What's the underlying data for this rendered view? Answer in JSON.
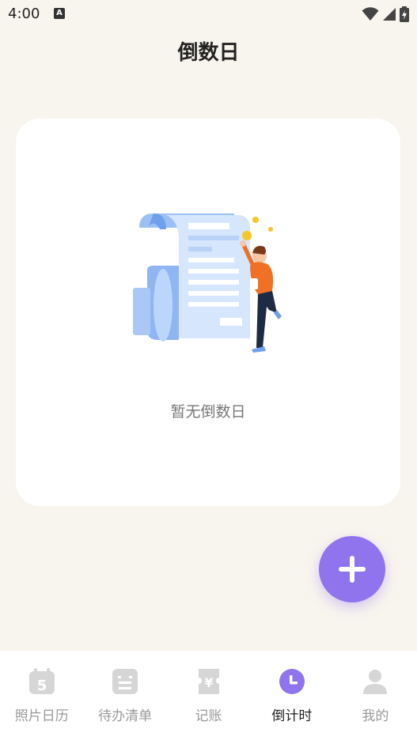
{
  "status_bar": {
    "time": "4:00",
    "keyboard_badge": "A"
  },
  "header": {
    "title": "倒数日"
  },
  "empty_state": {
    "message": "暂无倒数日"
  },
  "fab": {
    "icon": "plus-icon"
  },
  "tabbar": {
    "items": [
      {
        "label": "照片日历",
        "icon": "calendar-icon",
        "badge": "5",
        "active": false
      },
      {
        "label": "待办清单",
        "icon": "todo-list-icon",
        "active": false
      },
      {
        "label": "记账",
        "icon": "yen-receipt-icon",
        "badge": "¥",
        "active": false
      },
      {
        "label": "倒计时",
        "icon": "clock-icon",
        "active": true
      },
      {
        "label": "我的",
        "icon": "person-icon",
        "active": false
      }
    ]
  },
  "colors": {
    "accent": "#8f74ee",
    "background": "#f8f5ee",
    "inactive": "#d6d6d6"
  }
}
